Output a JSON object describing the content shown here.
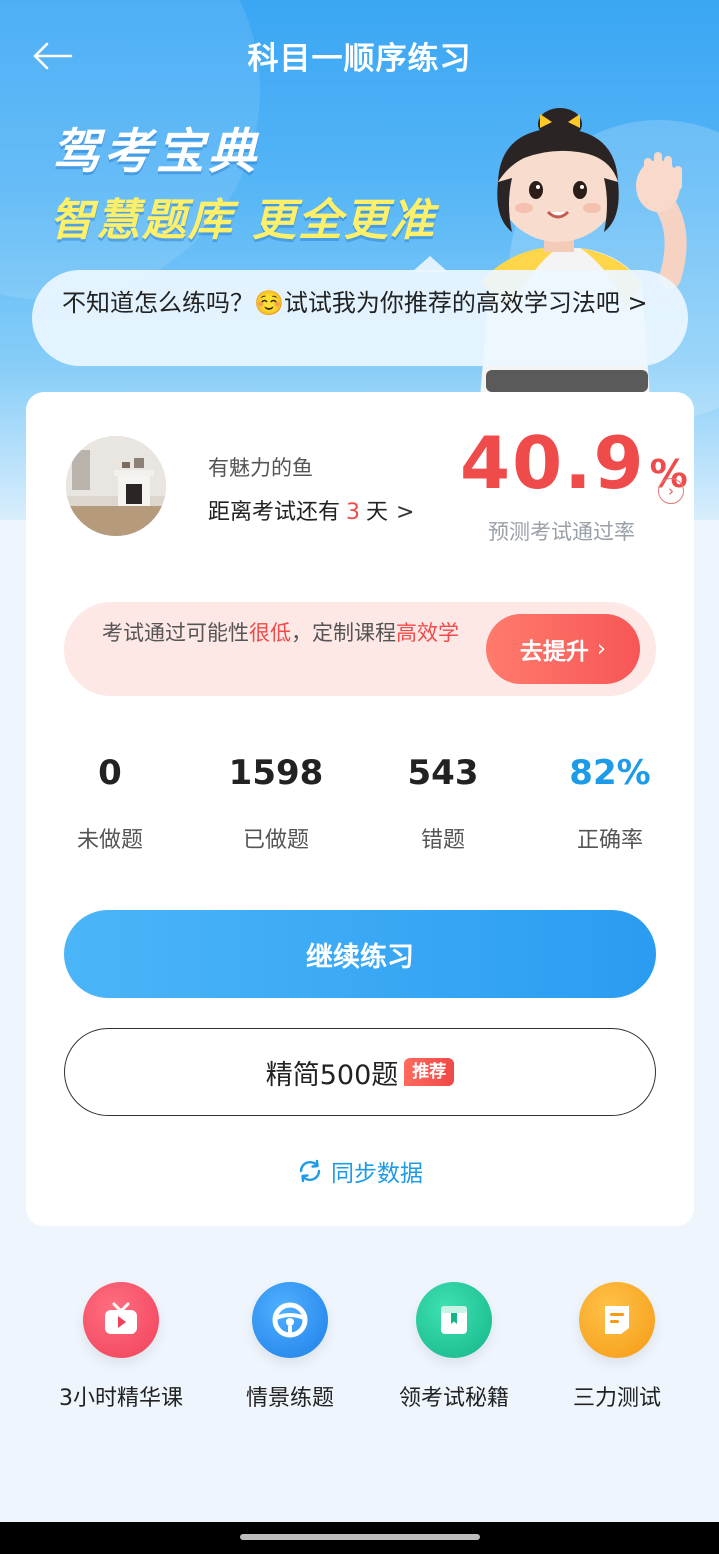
{
  "header": {
    "title": "科目一顺序练习",
    "back_icon": "arrow-left-icon"
  },
  "banner": {
    "line1": "驾考宝典",
    "line2_a": "智慧题库",
    "line2_b": "更全更准"
  },
  "tip": {
    "text": "不知道怎么练吗？☺️试试我为你推荐的高效学习法吧 >"
  },
  "profile": {
    "username": "有魅力的鱼",
    "countdown_prefix": "距离考试还有",
    "countdown_days": "3",
    "countdown_suffix": "天",
    "chevron": ">"
  },
  "pass_rate": {
    "value": "40.9",
    "unit": "%",
    "label": "预测考试通过率",
    "arrow": "›"
  },
  "promo": {
    "text_a": "考试通过可能性",
    "text_b": "很低",
    "text_c": "，定制课程",
    "text_d": "高效学",
    "button_label": "去提升",
    "button_chevron": "›"
  },
  "stats": [
    {
      "value": "0",
      "label": "未做题"
    },
    {
      "value": "1598",
      "label": "已做题"
    },
    {
      "value": "543",
      "label": "错题"
    },
    {
      "value": "82%",
      "label": "正确率"
    }
  ],
  "actions": {
    "continue_label": "继续练习",
    "simplified_label": "精简500题",
    "simplified_badge": "推荐",
    "sync_label": "同步数据"
  },
  "quick_links": [
    {
      "label": "3小时精华课",
      "icon": "play-video-icon",
      "color": "#f54a5f"
    },
    {
      "label": "情景练题",
      "icon": "steering-wheel-icon",
      "color": "#2f8ff0"
    },
    {
      "label": "领考试秘籍",
      "icon": "book-icon",
      "color": "#21c59a"
    },
    {
      "label": "三力测试",
      "icon": "document-icon",
      "color": "#f9a825"
    }
  ],
  "colors": {
    "accent_blue": "#1e9be8",
    "alert_red": "#ef4b4b",
    "banner_yellow": "#fff06a"
  }
}
